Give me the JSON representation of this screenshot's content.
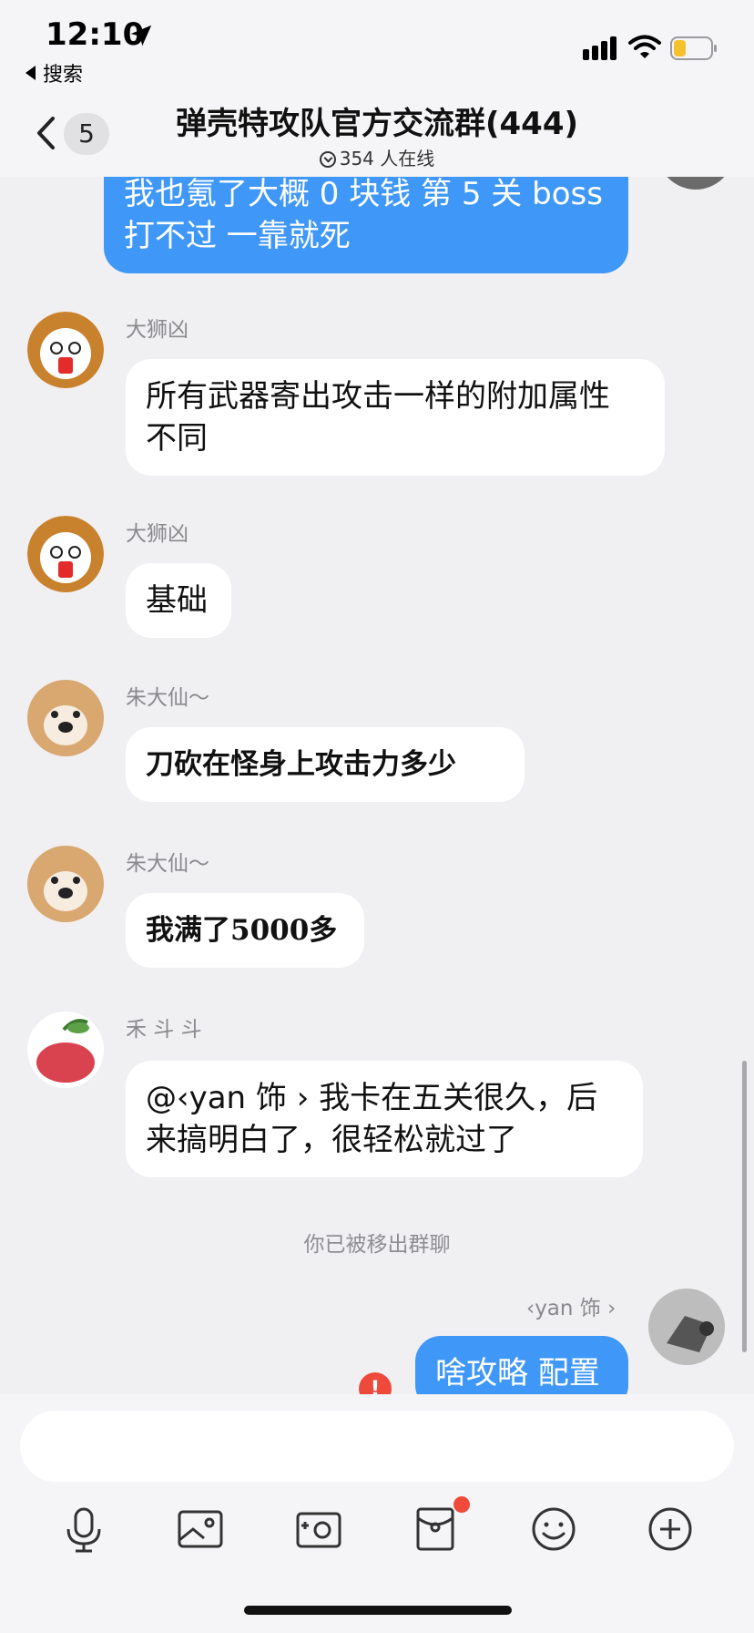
{
  "status_bar": {
    "time": "12:10",
    "back_app_label": "搜索"
  },
  "header": {
    "unread_count": "5",
    "title": "弹壳特攻队官方交流群(444)",
    "online_text": "354 人在线"
  },
  "messages": [
    {
      "direction": "out",
      "text_lines": [
        "我也氪了大概 0 块钱  第 5 关 boss",
        "打不过 一靠就死"
      ]
    },
    {
      "direction": "in",
      "sender": "大狮凶",
      "text_lines": [
        "所有武器寄出攻击一样的附加属性",
        "不同"
      ]
    },
    {
      "direction": "in",
      "sender": "大狮凶",
      "text_lines": [
        "基础"
      ]
    },
    {
      "direction": "in",
      "sender": "朱大仙～",
      "text_lines": [
        "刀砍在怪身上攻击力多少"
      ]
    },
    {
      "direction": "in",
      "sender": "朱大仙～",
      "text_lines": [
        "我满了5000多"
      ]
    },
    {
      "direction": "in",
      "sender": "禾 斗 斗",
      "text_lines": [
        "@‹yan 饰 › 我卡在五关很久，后",
        "来搞明白了，很轻松就过了"
      ]
    },
    {
      "direction": "out",
      "sender": "‹yan 饰 ›",
      "text_lines": [
        "啥攻略 配置"
      ],
      "send_failed": true
    }
  ],
  "system_message": "你已被移出群聊",
  "error_badge": "!",
  "input": {
    "placeholder": "",
    "value": ""
  },
  "toolbar": [
    "microphone-icon",
    "image-icon",
    "camera-icon",
    "red-packet-icon",
    "emoji-icon",
    "plus-icon"
  ],
  "colors": {
    "bubble_out": "#3f97f8",
    "bubble_in": "#ffffff",
    "background": "#f0f0f2",
    "badge_red": "#f04b3a"
  }
}
